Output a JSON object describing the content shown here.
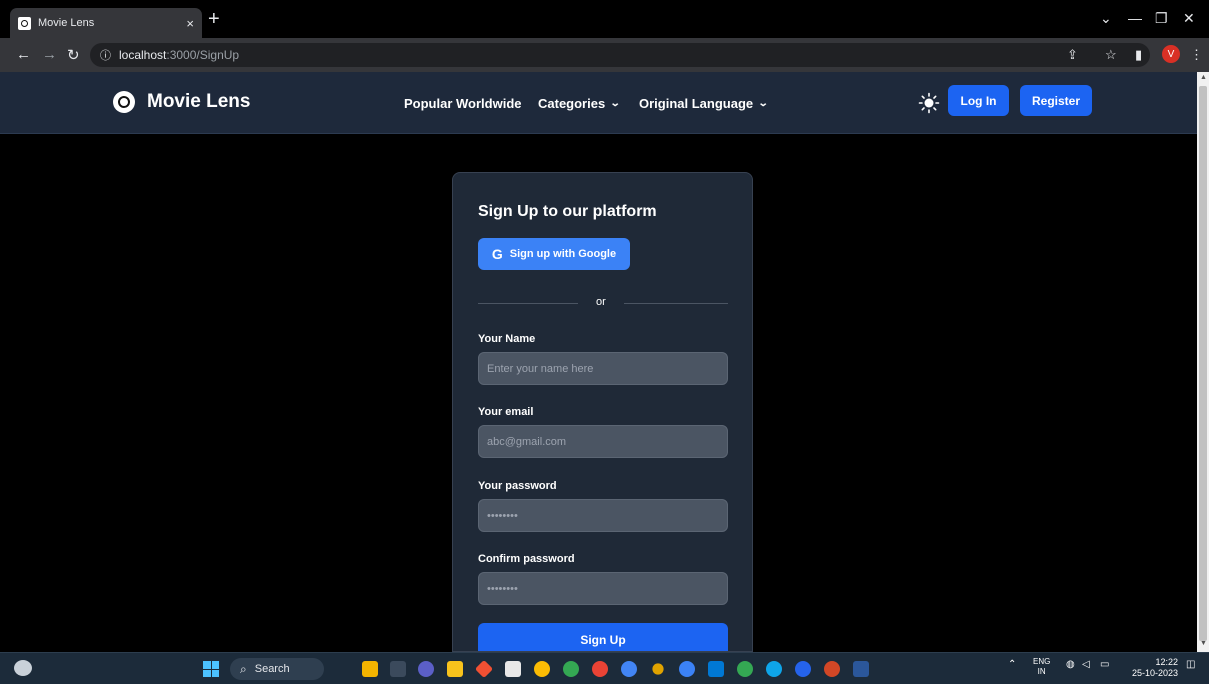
{
  "browser": {
    "tab_title": "Movie Lens",
    "tab_close": "×",
    "new_tab": "+",
    "url_host": "localhost",
    "url_path": ":3000/SignUp",
    "profile_initial": "V"
  },
  "navbar": {
    "brand": "Movie Lens",
    "links": [
      "Popular Worldwide",
      "Categories",
      "Original Language"
    ],
    "login": "Log In",
    "register": "Register"
  },
  "form": {
    "title": "Sign Up to our platform",
    "google_button": "Sign up with Google",
    "divider": "or",
    "name_label": "Your Name",
    "name_placeholder": "Enter your name here",
    "email_label": "Your email",
    "email_placeholder": "abc@gmail.com",
    "password_label": "Your password",
    "password_placeholder": "••••••••",
    "confirm_label": "Confirm password",
    "confirm_placeholder": "••••••••",
    "submit": "Sign Up"
  },
  "taskbar": {
    "search": "Search",
    "lang_top": "ENG",
    "lang_bottom": "IN",
    "time": "12:22",
    "date": "25-10-2023"
  },
  "colors": {
    "accent": "#1c64f2",
    "navbar_bg": "#1e293b",
    "card_bg": "#1f2937",
    "input_bg": "#4b5563"
  }
}
